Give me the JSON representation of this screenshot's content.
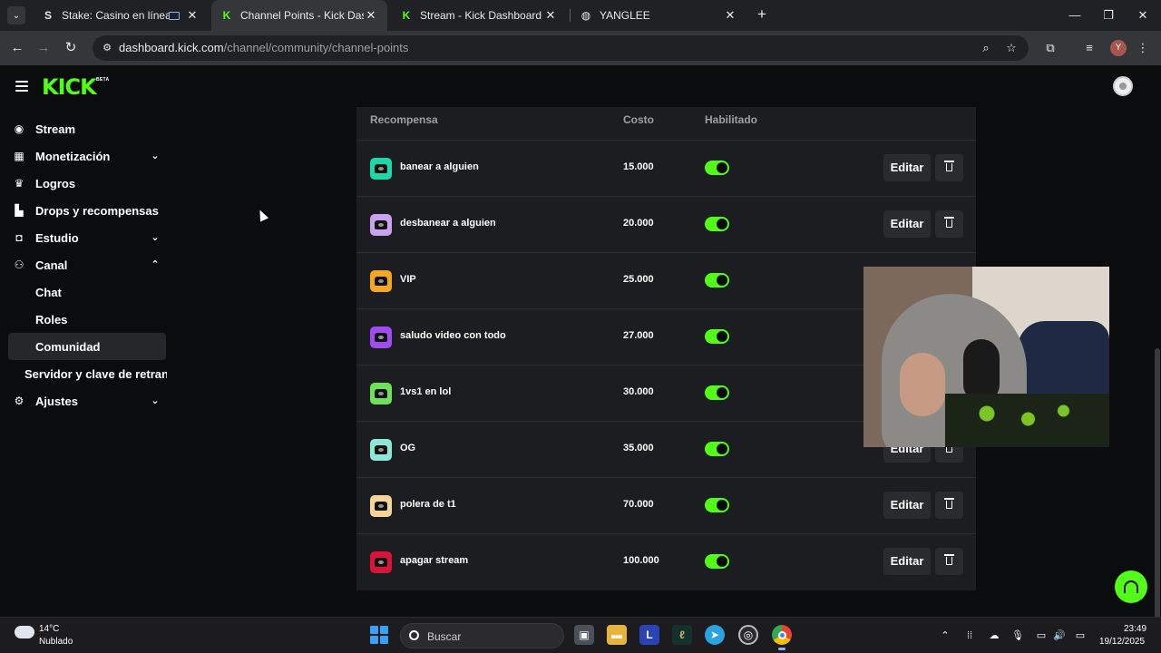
{
  "browser": {
    "tabs": [
      {
        "title": "Stake: Casino en línea y Apuestas",
        "favicon": "S",
        "favicon_color": "#e8eaed"
      },
      {
        "title": "Channel Points - Kick Dashboard",
        "favicon": "K",
        "favicon_color": "#53fc18"
      },
      {
        "title": "Stream - Kick Dashboard",
        "favicon": "K",
        "favicon_color": "#53fc18"
      },
      {
        "title": "YANGLEE",
        "favicon": "◍",
        "favicon_color": "#e8eaed"
      }
    ],
    "url_domain": "dashboard.kick.com",
    "url_path": "/channel/community/channel-points",
    "profile_initial": "Y"
  },
  "app": {
    "logo": "KICK",
    "logo_badge": "BETA",
    "accent": "#53fc18"
  },
  "sidebar": {
    "items": [
      {
        "label": "Stream",
        "icon": "broadcast-icon"
      },
      {
        "label": "Monetización",
        "icon": "chart-icon",
        "expandable": true
      },
      {
        "label": "Logros",
        "icon": "trophy-icon"
      },
      {
        "label": "Drops y recompensas",
        "icon": "gift-icon"
      },
      {
        "label": "Estudio",
        "icon": "studio-icon",
        "expandable": true
      },
      {
        "label": "Canal",
        "icon": "users-icon",
        "expanded": true
      },
      {
        "label": "Chat"
      },
      {
        "label": "Roles"
      },
      {
        "label": "Comunidad",
        "active": true
      },
      {
        "label": "Servidor y clave de retransmisión"
      },
      {
        "label": "Ajustes",
        "icon": "gear-icon",
        "expandable": true
      }
    ]
  },
  "table": {
    "headers": {
      "reward": "Recompensa",
      "cost": "Costo",
      "enabled": "Habilitado"
    },
    "edit_label": "Editar",
    "rows": [
      {
        "name": "banear a alguien",
        "cost": "15.000",
        "enabled": true,
        "color": "#1fd6a8"
      },
      {
        "name": "desbanear a alguien",
        "cost": "20.000",
        "enabled": true,
        "color": "#c9a2ef"
      },
      {
        "name": "VIP",
        "cost": "25.000",
        "enabled": true,
        "color": "#f5a623"
      },
      {
        "name": "saludo video con todo",
        "cost": "27.000",
        "enabled": true,
        "color": "#a14cf0"
      },
      {
        "name": "1vs1 en lol",
        "cost": "30.000",
        "enabled": true,
        "color": "#6ee05a"
      },
      {
        "name": "OG",
        "cost": "35.000",
        "enabled": true,
        "color": "#8ee8d6"
      },
      {
        "name": "polera de t1",
        "cost": "70.000",
        "enabled": true,
        "color": "#f7d49a"
      },
      {
        "name": "apagar stream",
        "cost": "100.000",
        "enabled": true,
        "color": "#d8143a"
      }
    ]
  },
  "taskbar": {
    "weather_temp": "14°C",
    "weather_desc": "Nublado",
    "search_placeholder": "Buscar",
    "time": "23:49",
    "date": "19/12/2025"
  }
}
